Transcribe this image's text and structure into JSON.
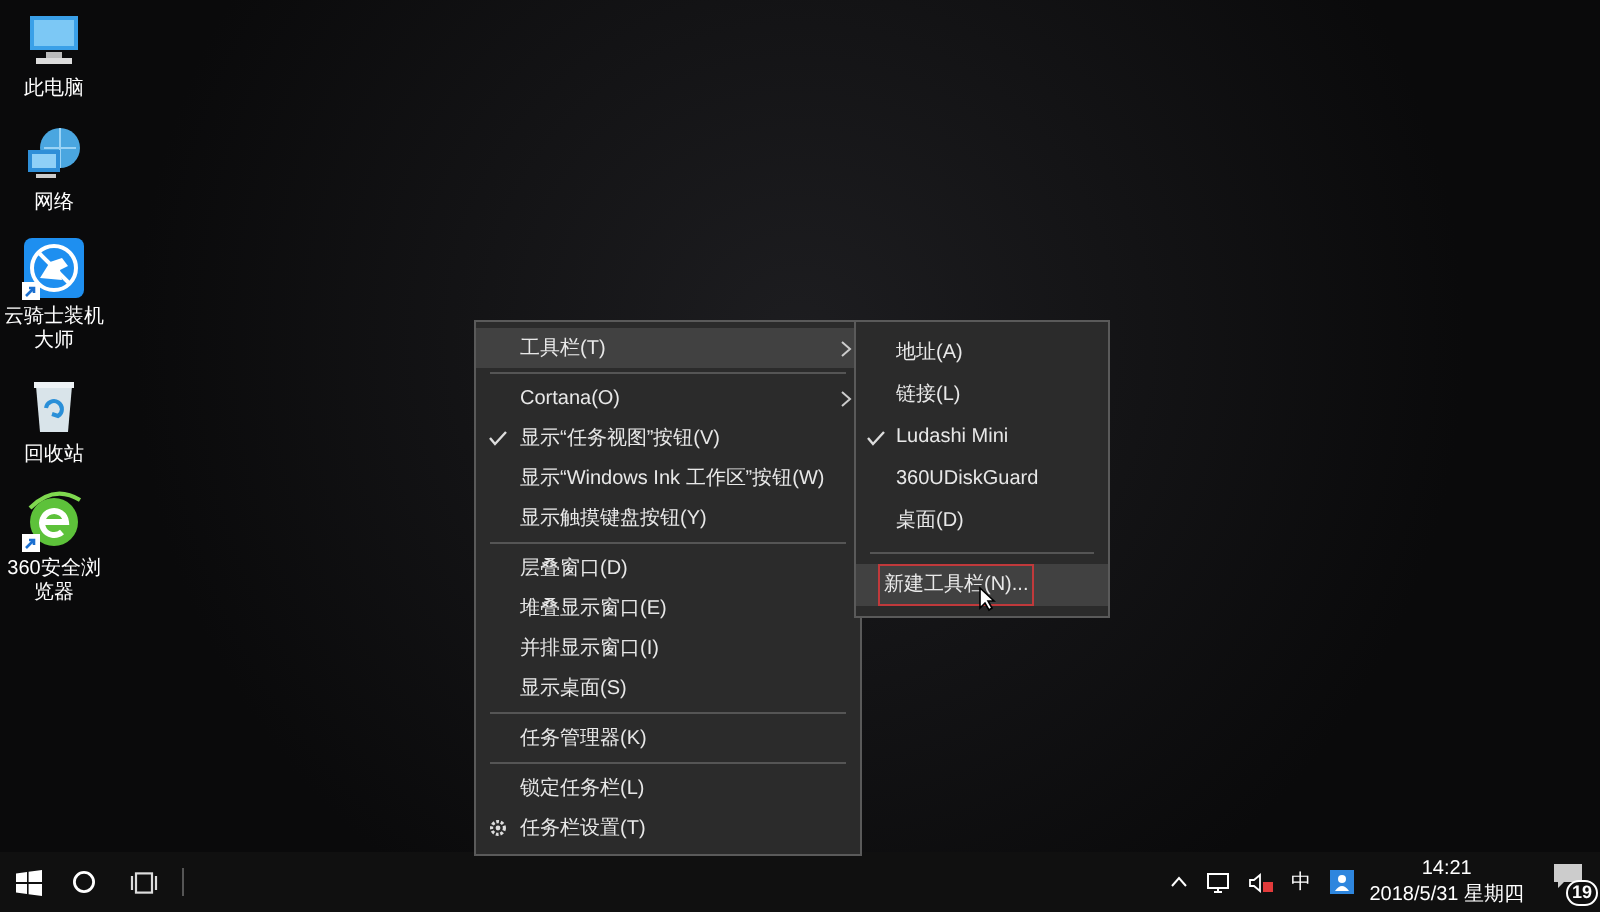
{
  "desktop_icons": [
    {
      "label": "此电脑",
      "kind": "computer"
    },
    {
      "label": "网络",
      "kind": "network"
    },
    {
      "label": "云骑士装机大师",
      "kind": "app-blue",
      "shortcut": true
    },
    {
      "label": "回收站",
      "kind": "recycle"
    },
    {
      "label": "360安全浏览器",
      "kind": "browser",
      "shortcut": true
    }
  ],
  "context_menu": {
    "items": [
      {
        "kind": "item",
        "label": "工具栏(T)",
        "submenu": true,
        "selected": true,
        "checked": false
      },
      {
        "kind": "separator"
      },
      {
        "kind": "item",
        "label": "Cortana(O)",
        "submenu": true,
        "selected": false,
        "checked": false
      },
      {
        "kind": "item",
        "label": "显示“任务视图”按钮(V)",
        "submenu": false,
        "selected": false,
        "checked": true
      },
      {
        "kind": "item",
        "label": "显示“Windows Ink 工作区”按钮(W)",
        "submenu": false,
        "selected": false,
        "checked": false
      },
      {
        "kind": "item",
        "label": "显示触摸键盘按钮(Y)",
        "submenu": false,
        "selected": false,
        "checked": false
      },
      {
        "kind": "separator"
      },
      {
        "kind": "item",
        "label": "层叠窗口(D)",
        "submenu": false,
        "selected": false,
        "checked": false
      },
      {
        "kind": "item",
        "label": "堆叠显示窗口(E)",
        "submenu": false,
        "selected": false,
        "checked": false
      },
      {
        "kind": "item",
        "label": "并排显示窗口(I)",
        "submenu": false,
        "selected": false,
        "checked": false
      },
      {
        "kind": "item",
        "label": "显示桌面(S)",
        "submenu": false,
        "selected": false,
        "checked": false
      },
      {
        "kind": "separator"
      },
      {
        "kind": "item",
        "label": "任务管理器(K)",
        "submenu": false,
        "selected": false,
        "checked": false
      },
      {
        "kind": "separator"
      },
      {
        "kind": "item",
        "label": "锁定任务栏(L)",
        "submenu": false,
        "selected": false,
        "checked": false
      },
      {
        "kind": "settings",
        "label": "任务栏设置(T)",
        "submenu": false,
        "selected": false,
        "checked": false
      }
    ]
  },
  "toolbar_submenu": {
    "items": [
      {
        "kind": "item",
        "label": "地址(A)",
        "selected": false,
        "checked": false
      },
      {
        "kind": "item",
        "label": "链接(L)",
        "selected": false,
        "checked": false
      },
      {
        "kind": "item",
        "label": "Ludashi Mini",
        "selected": false,
        "checked": true
      },
      {
        "kind": "item",
        "label": "360UDiskGuard",
        "selected": false,
        "checked": false
      },
      {
        "kind": "item",
        "label": "桌面(D)",
        "selected": false,
        "checked": false
      },
      {
        "kind": "separator"
      },
      {
        "kind": "item",
        "label": "新建工具栏(N)...",
        "selected": true,
        "checked": false
      }
    ]
  },
  "taskbar": {
    "ime": "中",
    "time": "14:21",
    "date": "2018/5/31 星期四",
    "notifications": "19",
    "volume_muted": true
  }
}
